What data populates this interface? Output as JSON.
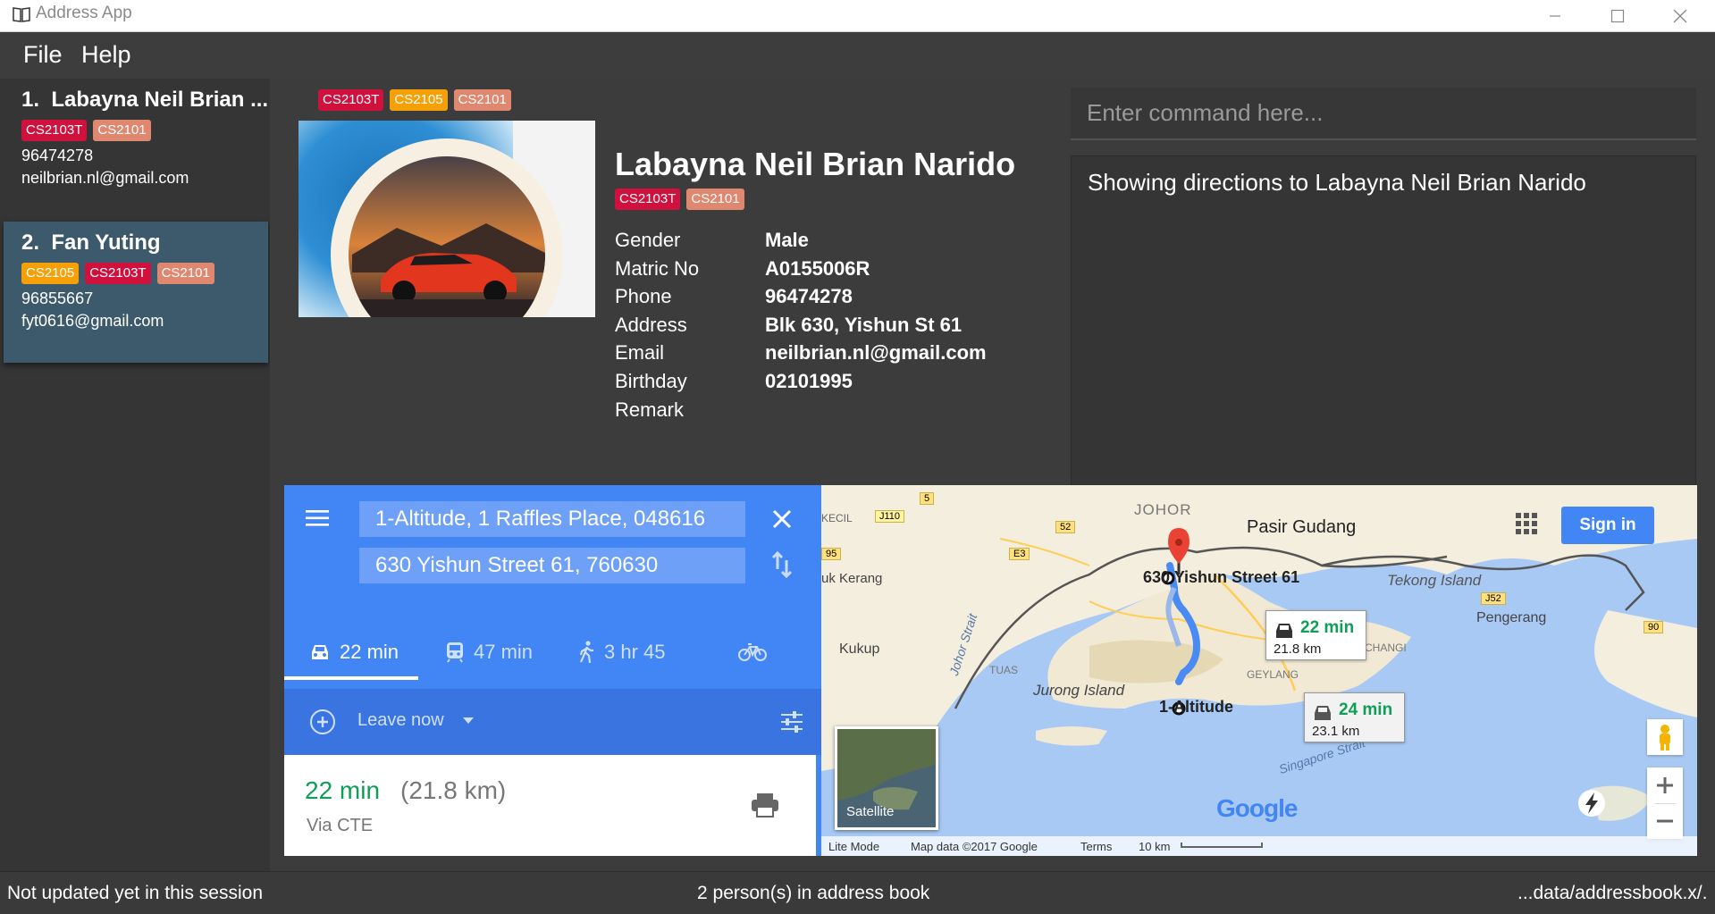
{
  "window": {
    "title": "Address App"
  },
  "menu": {
    "file": "File",
    "help": "Help"
  },
  "person_list": [
    {
      "index": "1.",
      "name": "Labayna Neil Brian ...",
      "tags": [
        "CS2103T",
        "CS2101"
      ],
      "phone": "96474278",
      "email": "neilbrian.nl@gmail.com",
      "selected": false
    },
    {
      "index": "2.",
      "name": "Fan Yuting",
      "tags": [
        "CS2105",
        "CS2103T",
        "CS2101"
      ],
      "phone": "96855667",
      "email": "fyt0616@gmail.com",
      "selected": true
    }
  ],
  "header_tags": [
    "CS2103T",
    "CS2105",
    "CS2101"
  ],
  "profile": {
    "name": "Labayna Neil Brian Narido",
    "tags": [
      "CS2103T",
      "CS2101"
    ],
    "fields": [
      {
        "label": "Gender",
        "value": "Male"
      },
      {
        "label": "Matric No",
        "value": "A0155006R"
      },
      {
        "label": "Phone",
        "value": "96474278"
      },
      {
        "label": "Address",
        "value": "Blk 630, Yishun St 61"
      },
      {
        "label": "Email",
        "value": "neilbrian.nl@gmail.com"
      },
      {
        "label": "Birthday",
        "value": "02101995"
      },
      {
        "label": "Remark",
        "value": ""
      }
    ]
  },
  "command": {
    "placeholder": "Enter command here...",
    "value": ""
  },
  "result": {
    "text": "Showing directions to Labayna Neil Brian Narido"
  },
  "directions": {
    "origin": "1-Altitude, 1 Raffles Place, 048616",
    "destination": "630 Yishun Street 61, 760630",
    "modes": [
      {
        "icon": "car-icon",
        "label": "22 min",
        "active": true
      },
      {
        "icon": "train-icon",
        "label": "47 min",
        "active": false
      },
      {
        "icon": "walk-icon",
        "label": "3 hr 45",
        "active": false
      },
      {
        "icon": "bicycle-icon",
        "label": "",
        "active": false
      }
    ],
    "leave_now": "Leave now",
    "route_time": "22 min",
    "route_distance": "(21.8 km)",
    "route_via": "Via CTE"
  },
  "map": {
    "sign_in": "Sign in",
    "satellite": "Satellite",
    "labels": {
      "johor": "JOHOR",
      "pasir_gudang": "Pasir Gudang",
      "tekong": "Tekong Island",
      "pengerang": "Pengerang",
      "kukup": "Kukup",
      "jurong": "Jurong Island",
      "tuas": "TUAS",
      "changi": "CHANGI",
      "geylang": "GEYLANG",
      "kerang": "uk Kerang",
      "kecil": "KECIL",
      "johor_strait": "Johor Strait",
      "singapore_strait": "Singapore Strait",
      "dest_label": "630 Yishun Street 61",
      "origin_label": "1-Altitude",
      "j110": "J110",
      "r5": "5",
      "r52": "52",
      "e3": "E3",
      "r95": "95",
      "j52": "J52",
      "r90": "90"
    },
    "route_box_1": {
      "time": "22 min",
      "dist": "21.8 km"
    },
    "route_box_2": {
      "time": "24 min",
      "dist": "23.1 km"
    },
    "footer": {
      "lite_mode": "Lite Mode",
      "map_data": "Map data ©2017 Google",
      "terms": "Terms",
      "scale": "10 km"
    },
    "google": "Google"
  },
  "status": {
    "left": "Not updated yet in this session",
    "center": "2 person(s) in address book",
    "right": "...data/addressbook.x/."
  },
  "colors": {
    "tag_red": "#d0103d",
    "tag_orange": "#f5a006",
    "tag_salmon": "#e08770",
    "selected_card": "#3d5a6c",
    "google_blue": "#4285f4",
    "route_green": "#0f9d58"
  }
}
